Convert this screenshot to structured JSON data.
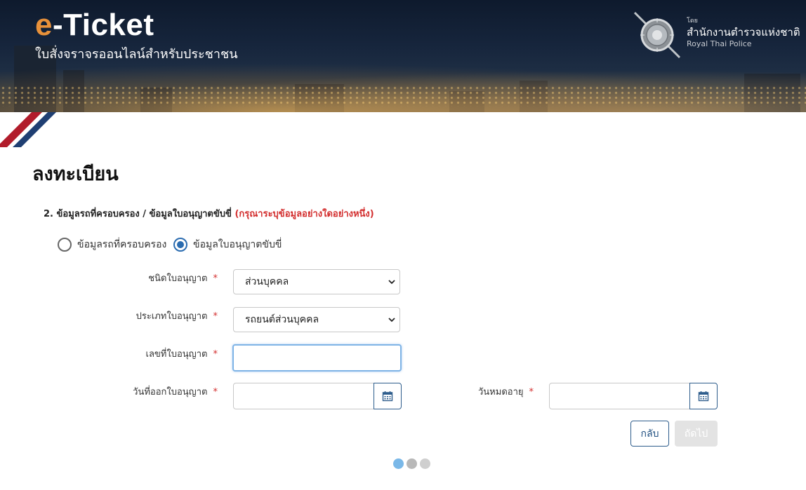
{
  "header": {
    "brand_e": "e",
    "brand_rest": "-Ticket",
    "subtitle": "ใบสั่งจราจรออนไลน์สำหรับประชาชน",
    "agency_by": "โดย",
    "agency_name_th": "สำนักงานตำรวจแห่งชาติ",
    "agency_name_en": "Royal Thai Police"
  },
  "page": {
    "title": "ลงทะเบียน"
  },
  "section": {
    "heading": "2. ข้อมูลรถที่ครอบครอง / ข้อมูลใบอนุญาตขับขี่",
    "note": "(กรุณาระบุข้อมูลอย่างใดอย่างหนึ่ง)"
  },
  "radios": [
    {
      "label": "ข้อมูลรถที่ครอบครอง",
      "checked": false
    },
    {
      "label": "ข้อมูลใบอนุญาตขับขี่",
      "checked": true
    }
  ],
  "form": {
    "required_mark": "*",
    "license_kind": {
      "label": "ชนิดใบอนุญาต",
      "value": "ส่วนบุคคล"
    },
    "license_type": {
      "label": "ประเภทใบอนุญาต",
      "value": "รถยนต์ส่วนบุคคล"
    },
    "license_number": {
      "label": "เลขที่ใบอนุญาต",
      "value": ""
    },
    "issue_date": {
      "label": "วันที่ออกใบอนุญาต",
      "value": ""
    },
    "expiry_date": {
      "label": "วันหมดอายุ",
      "value": ""
    }
  },
  "buttons": {
    "back": "กลับ",
    "next": "ถัดไป"
  },
  "steps": {
    "total": 3,
    "current": 1
  },
  "colors": {
    "brand_orange": "#e8913a",
    "required_red": "#d32f2f",
    "primary_blue": "#2e5d8c",
    "radio_blue": "#2b6cb0",
    "step_active": "#7ab8e8"
  }
}
